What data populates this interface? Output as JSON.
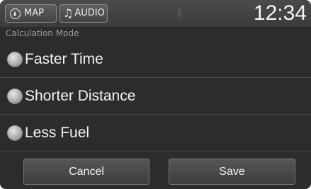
{
  "topbar": {
    "map_label": "MAP",
    "audio_label": "AUDIO",
    "clock": "12:34",
    "icons": [
      "compass-icon",
      "music-note-icon",
      "bluetooth-icon"
    ]
  },
  "header": {
    "title": "Calculation Mode"
  },
  "options": [
    {
      "label": "Faster Time"
    },
    {
      "label": "Shorter Distance"
    },
    {
      "label": "Less Fuel"
    }
  ],
  "buttons": {
    "cancel": "Cancel",
    "save": "Save"
  },
  "colors": {
    "background": "#2b2c2d",
    "text": "#f3f3f3",
    "subtle_text": "#9a9b9d"
  }
}
